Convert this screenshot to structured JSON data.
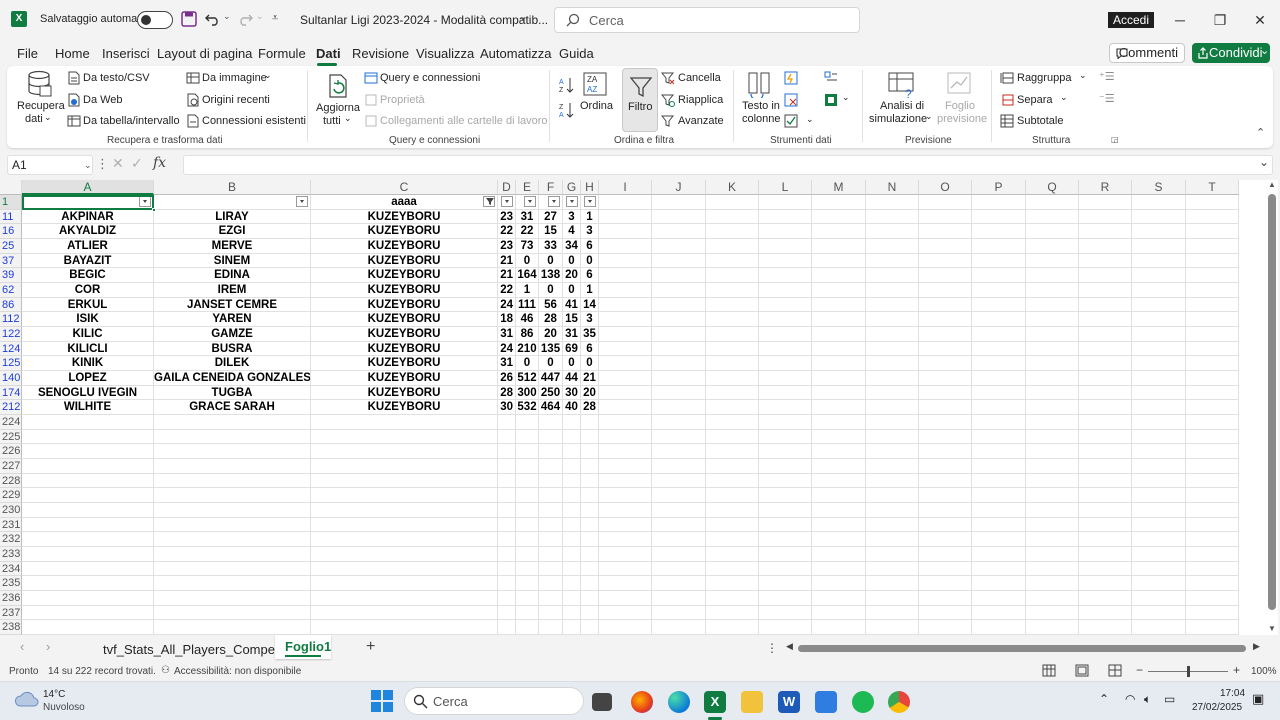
{
  "titlebar": {
    "autosave_label": "Salvataggio automatico",
    "doc_title": "Sultanlar Ligi 2023-2024 - Modalità compatib...",
    "search_placeholder": "Cerca",
    "signin_label": "Accedi"
  },
  "menu": {
    "items": [
      "File",
      "Home",
      "Inserisci",
      "Layout di pagina",
      "Formule",
      "Dati",
      "Revisione",
      "Visualizza",
      "Automatizza",
      "Guida"
    ],
    "active": "Dati",
    "comments_label": "Commenti",
    "share_label": "Condividi"
  },
  "ribbon": {
    "get_data": {
      "recupera_line1": "Recupera",
      "recupera_line2": "dati",
      "da_testo": "Da testo/CSV",
      "da_web": "Da Web",
      "da_tabella": "Da tabella/intervallo",
      "da_immagine": "Da immagine",
      "origini_recenti": "Origini recenti",
      "connessioni_esistenti": "Connessioni esistenti",
      "group_label": "Recupera e trasforma dati"
    },
    "queries": {
      "aggiorna_line1": "Aggiorna",
      "aggiorna_line2": "tutti",
      "query_connessioni": "Query e connessioni",
      "proprieta": "Proprietà",
      "collegamenti": "Collegamenti alle cartelle di lavoro",
      "group_label": "Query e connessioni"
    },
    "sort_filter": {
      "ordina": "Ordina",
      "filtro": "Filtro",
      "cancella": "Cancella",
      "riapplica": "Riapplica",
      "avanzate": "Avanzate",
      "group_label": "Ordina e filtra"
    },
    "data_tools": {
      "testo_line1": "Testo in",
      "testo_line2": "colonne",
      "group_label": "Strumenti dati"
    },
    "forecast": {
      "analisi_line1": "Analisi di",
      "analisi_line2": "simulazione",
      "foglio_line1": "Foglio",
      "foglio_line2": "previsione",
      "group_label": "Previsione"
    },
    "outline": {
      "raggruppa": "Raggruppa",
      "separa": "Separa",
      "subtotale": "Subtotale",
      "group_label": "Struttura"
    }
  },
  "formula_bar": {
    "name_box": "A1",
    "fx_label": "fx",
    "formula": ""
  },
  "grid": {
    "columns": [
      "A",
      "B",
      "C",
      "D",
      "E",
      "F",
      "G",
      "H",
      "I",
      "J",
      "K",
      "L",
      "M",
      "N",
      "O",
      "P",
      "Q",
      "R",
      "S",
      "T"
    ],
    "header_row": {
      "row": "1",
      "c_label": "aaaa"
    },
    "rows": [
      {
        "row": "11",
        "a": "AKPINAR",
        "b": "LIRAY",
        "c": "KUZEYBORU",
        "d": "23",
        "e": "31",
        "f": "27",
        "g": "3",
        "h": "1"
      },
      {
        "row": "16",
        "a": "AKYALDIZ",
        "b": "EZGI",
        "c": "KUZEYBORU",
        "d": "22",
        "e": "22",
        "f": "15",
        "g": "4",
        "h": "3"
      },
      {
        "row": "25",
        "a": "ATLIER",
        "b": "MERVE",
        "c": "KUZEYBORU",
        "d": "23",
        "e": "73",
        "f": "33",
        "g": "34",
        "h": "6"
      },
      {
        "row": "37",
        "a": "BAYAZIT",
        "b": "SINEM",
        "c": "KUZEYBORU",
        "d": "21",
        "e": "0",
        "f": "0",
        "g": "0",
        "h": "0"
      },
      {
        "row": "39",
        "a": "BEGIC",
        "b": "EDINA",
        "c": "KUZEYBORU",
        "d": "21",
        "e": "164",
        "f": "138",
        "g": "20",
        "h": "6"
      },
      {
        "row": "62",
        "a": "COR",
        "b": "IREM",
        "c": "KUZEYBORU",
        "d": "22",
        "e": "1",
        "f": "0",
        "g": "0",
        "h": "1"
      },
      {
        "row": "86",
        "a": "ERKUL",
        "b": "JANSET CEMRE",
        "c": "KUZEYBORU",
        "d": "24",
        "e": "111",
        "f": "56",
        "g": "41",
        "h": "14"
      },
      {
        "row": "112",
        "a": "ISIK",
        "b": "YAREN",
        "c": "KUZEYBORU",
        "d": "18",
        "e": "46",
        "f": "28",
        "g": "15",
        "h": "3"
      },
      {
        "row": "122",
        "a": "KILIC",
        "b": "GAMZE",
        "c": "KUZEYBORU",
        "d": "31",
        "e": "86",
        "f": "20",
        "g": "31",
        "h": "35"
      },
      {
        "row": "124",
        "a": "KILICLI",
        "b": "BUSRA",
        "c": "KUZEYBORU",
        "d": "24",
        "e": "210",
        "f": "135",
        "g": "69",
        "h": "6"
      },
      {
        "row": "125",
        "a": "KINIK",
        "b": "DILEK",
        "c": "KUZEYBORU",
        "d": "31",
        "e": "0",
        "f": "0",
        "g": "0",
        "h": "0"
      },
      {
        "row": "140",
        "a": "LOPEZ",
        "b": "GAILA CENEIDA GONZALES",
        "c": "KUZEYBORU",
        "d": "26",
        "e": "512",
        "f": "447",
        "g": "44",
        "h": "21"
      },
      {
        "row": "174",
        "a": "SENOGLU IVEGIN",
        "b": "TUGBA",
        "c": "KUZEYBORU",
        "d": "28",
        "e": "300",
        "f": "250",
        "g": "30",
        "h": "20"
      },
      {
        "row": "212",
        "a": "WILHITE",
        "b": "GRACE SARAH",
        "c": "KUZEYBORU",
        "d": "30",
        "e": "532",
        "f": "464",
        "g": "40",
        "h": "28"
      }
    ],
    "empty_rows": [
      "224",
      "225",
      "226",
      "227",
      "228",
      "229",
      "230",
      "231",
      "232",
      "233",
      "234",
      "235",
      "236",
      "237",
      "238"
    ]
  },
  "sheets": {
    "tabs": [
      "tvf_Stats_All_Players_Competiti",
      "Foglio1"
    ],
    "active": "Foglio1"
  },
  "statusbar": {
    "mode": "Pronto",
    "records": "14 su 222 record trovati.",
    "accessibility": "Accessibilità: non disponibile",
    "zoom": "100%"
  },
  "taskbar": {
    "temp": "14°C",
    "weather": "Nuvoloso",
    "search_placeholder": "Cerca",
    "time": "17:04",
    "date": "27/02/2025"
  },
  "colors": {
    "excel_green": "#107c41",
    "row_filtered_blue": "#1e3dd6"
  }
}
